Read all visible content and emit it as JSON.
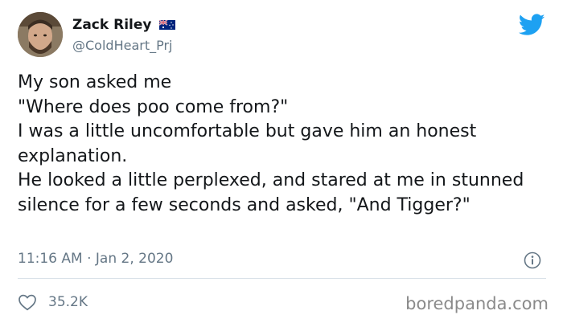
{
  "user": {
    "display_name": "Zack Riley",
    "handle": "@ColdHeart_Prj",
    "flag_icon": "australia-flag-icon"
  },
  "tweet": {
    "text": "My son asked me\n\"Where does poo come from?\"\nI was a little uncomfortable but gave him an honest explanation.\nHe looked a little perplexed, and stared at me in stunned silence for a few seconds and asked, \"And Tigger?\"",
    "timestamp": "11:16 AM · Jan 2, 2020"
  },
  "stats": {
    "likes": "35.2K"
  },
  "watermark": "boredpanda.com",
  "colors": {
    "twitter_blue": "#1da1f2",
    "secondary_text": "#657786",
    "divider": "#d9e1e8"
  },
  "icons": {
    "logo": "twitter-bird-icon",
    "info": "info-icon",
    "like": "heart-icon"
  }
}
